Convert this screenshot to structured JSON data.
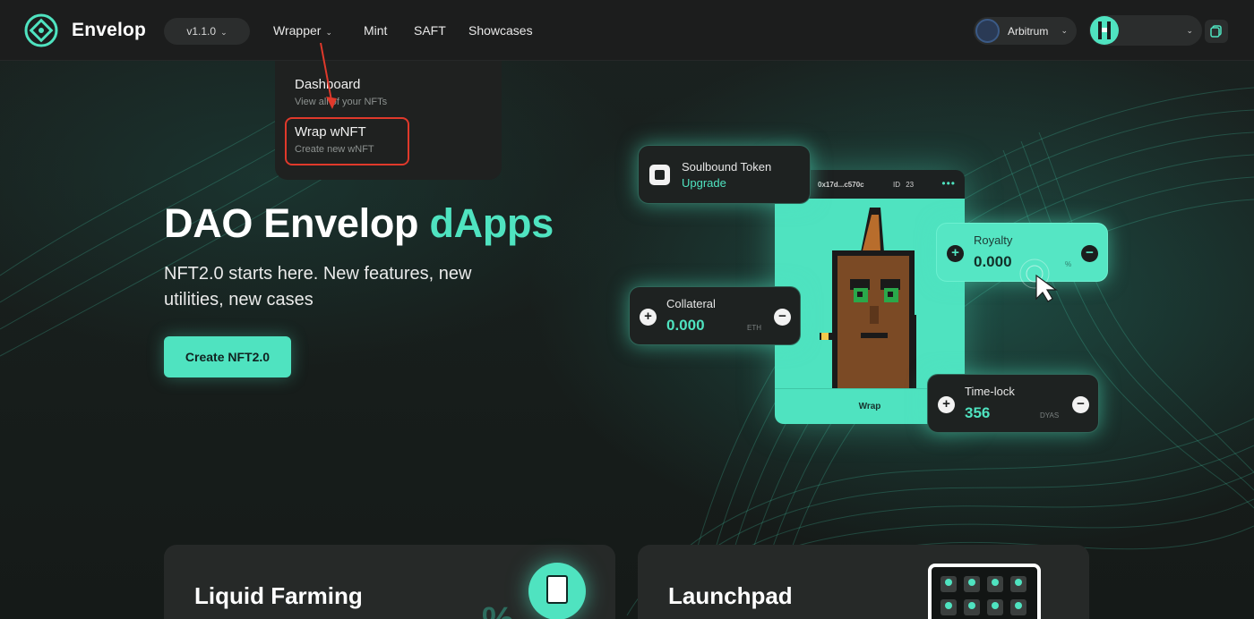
{
  "header": {
    "brand": "Envelop",
    "version": "v1.1.0",
    "nav": [
      {
        "label": "Wrapper"
      },
      {
        "label": "Mint"
      },
      {
        "label": "SAFT"
      },
      {
        "label": "Showcases"
      }
    ],
    "network": "Arbitrum",
    "wallet_address": ""
  },
  "dropdown": {
    "items": [
      {
        "title": "Dashboard",
        "subtitle": "View all of your NFTs"
      },
      {
        "title": "Wrap wNFT",
        "subtitle": "Create new wNFT"
      }
    ]
  },
  "hero": {
    "title_main": "DAO Envelop",
    "title_accent": "dApps",
    "subtitle": "NFT2.0 starts here. New features, new utilities, new cases",
    "cta": "Create NFT2.0"
  },
  "nft_card": {
    "address": "0x17d...c570c",
    "id_label": "ID",
    "id_value": "23",
    "wrap_label": "Wrap"
  },
  "panels": {
    "soulbound": {
      "title": "Soulbound Token",
      "link": "Upgrade"
    },
    "royalty": {
      "label": "Royalty",
      "value": "0.000",
      "unit": "%"
    },
    "collateral": {
      "label": "Collateral",
      "value": "0.000",
      "unit": "ETH"
    },
    "timelock": {
      "label": "Time-lock",
      "value": "356",
      "unit": "DYAS"
    }
  },
  "cards": [
    {
      "title": "Liquid Farming"
    },
    {
      "title": "Launchpad"
    }
  ],
  "colors": {
    "accent": "#4fe3c0",
    "highlight": "#e0392b",
    "background": "#141816"
  }
}
